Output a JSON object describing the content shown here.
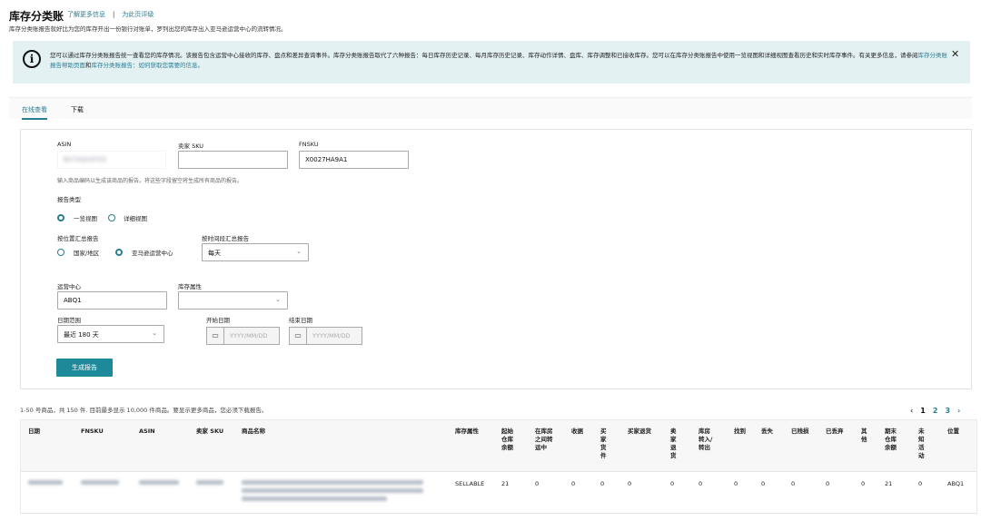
{
  "header": {
    "title": "库存分类账",
    "learn_more": "了解更多信息",
    "separator": "|",
    "rate_page": "为此页评级",
    "description": "库存分类账报告就好比为您的库存开出一份银行对账单，罗列出您的库存出入亚马逊运营中心的流转情况。"
  },
  "banner": {
    "icon": "info-icon",
    "text": "您可以通过库存分类账报告统一查看您的库存情况。该报告包含运营中心接收的库存、盘点和差异查询事件。库存分类账报告取代了六种报告：每日库存历史记录、每月库存历史记录、库存动作详情、盘库、库存调整和已接收库存。您可以在库存分类账报告中使用一览视图和详细视图查看历史和实时库存事件。有关更多信息，请参阅",
    "link1": "库存分类账报告帮助页面",
    "and": "和",
    "link2": "库存分类账报告：如何获取您需要的信息。",
    "close": "✕"
  },
  "tabs": [
    {
      "label": "在线查看",
      "active": true
    },
    {
      "label": "下载",
      "active": false
    }
  ],
  "form": {
    "asin_label": "ASIN",
    "asin_value": "B07XQ4XF5G",
    "sku_label": "卖家 SKU",
    "sku_value": "",
    "fnsku_label": "FNSKU",
    "fnsku_value": "X0027HA9A1",
    "hint": "输入商品编码以生成该商品的报告。将这些字段留空将生成所有商品的报告。",
    "report_type_label": "报告类型",
    "report_types": [
      {
        "label": "一览视图",
        "selected": true
      },
      {
        "label": "详细视图",
        "selected": false
      }
    ],
    "location_label": "按位置汇总报告",
    "locations": [
      {
        "label": "国家/地区",
        "selected": false
      },
      {
        "label": "亚马逊运营中心",
        "selected": true
      }
    ],
    "period_label": "按时间段汇总报告",
    "period_value": "每天",
    "fc_label": "运营中心",
    "fc_value": "ABQ1",
    "disposition_label": "库存属性",
    "disposition_value": "",
    "range_label": "日期范围",
    "range_value": "最近 180 天",
    "start_label": "开始日期",
    "start_placeholder": "YYYY/MM/DD",
    "end_label": "结束日期",
    "end_placeholder": "YYYY/MM/DD",
    "submit": "生成报告"
  },
  "results": {
    "count_text": "1-50 号商品，共 150 件. 目前最多显示 10,000 件商品。要显示更多商品，您必须下载报告。",
    "pager": {
      "prev": "‹",
      "pages": [
        "1",
        "2",
        "3"
      ],
      "current": "1",
      "next": "›"
    },
    "columns": [
      "日期",
      "FNSKU",
      "ASIN",
      "卖家 SKU",
      "商品名称",
      "库存属性",
      "起始\n仓库\n余额",
      "在库房\n之间转\n运中",
      "收据",
      "买\n家\n货\n件",
      "买家退货",
      "卖\n家\n退\n货",
      "库房\n转入/\n转出",
      "找到",
      "丢失",
      "已残损",
      "已丢弃",
      "其\n他",
      "期末\n仓库\n余额",
      "未\n知\n活\n动",
      "位置"
    ],
    "rows": [
      {
        "disposition": "SELLABLE",
        "values": [
          "21",
          "0",
          "0",
          "0",
          "0",
          "0",
          "0",
          "0",
          "0",
          "0",
          "0",
          "0",
          "21",
          "0"
        ],
        "location": "ABQ1"
      }
    ]
  }
}
